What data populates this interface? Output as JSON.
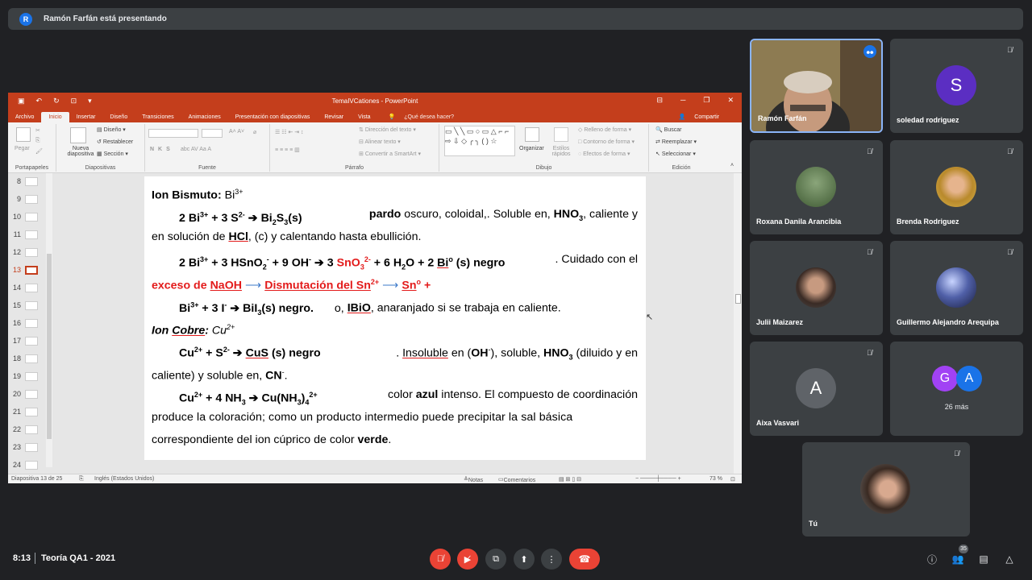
{
  "presenting_banner": {
    "avatar_letter": "R",
    "text": "Ramón Farfán está presentando"
  },
  "ppt": {
    "window_title": "TemaIVCationes - PowerPoint",
    "tabs": [
      "Archivo",
      "Inicio",
      "Insertar",
      "Diseño",
      "Transiciones",
      "Animaciones",
      "Presentación con diapositivas",
      "Revisar",
      "Vista"
    ],
    "tell_me": "¿Qué desea hacer?",
    "share": "Compartir",
    "ribbon": {
      "paste": "Pegar",
      "new_slide": "Nueva diapositiva",
      "layout": "Diseño",
      "reset": "Restablecer",
      "section": "Sección",
      "text_direction": "Dirección del texto",
      "align_text": "Alinear texto",
      "convert_smartart": "Convertir a SmartArt",
      "arrange": "Organizar",
      "quick_styles": "Estilos rápidos",
      "shape_fill": "Relleno de forma",
      "shape_outline": "Contorno de forma",
      "shape_effects": "Efectos de forma",
      "find": "Buscar",
      "replace": "Reemplazar",
      "select": "Seleccionar",
      "groups": [
        "Portapapeles",
        "Diapositivas",
        "Fuente",
        "Párrafo",
        "Dibujo",
        "Edición"
      ]
    },
    "thumbnails": [
      "8",
      "9",
      "10",
      "11",
      "12",
      "13",
      "14",
      "15",
      "16",
      "17",
      "18",
      "19",
      "20",
      "21",
      "22",
      "23",
      "24"
    ],
    "selected_slide": "13",
    "slide": {
      "l1_label": "Ion Bismuto:",
      "l1_ion": "Bi",
      "l1_sup": "3+",
      "l2_a": "2 Bi",
      "l2_a_sup": "3+",
      "l2_b": " + 3 S",
      "l2_b_sup": "2-",
      "l2_arrow": " ➔ ",
      "l2_c": "Bi",
      "l2_c_sub1": "2",
      "l2_c2": "S",
      "l2_c_sub2": "3",
      "l2_c3": "(s)",
      "l2_pardo": "pardo",
      "l2_rest": " oscuro, coloidal,. Soluble en, ",
      "l2_hno3": "HNO",
      "l2_hno3_sub": "3",
      "l2_end": ", caliente y",
      "l3_a": "en solución de ",
      "l3_hcl": "HCl",
      "l3_b": ", (c) y calentando hasta ebullición.",
      "l4_a": "2 Bi",
      "l4_a_sup": "3+",
      "l4_b": " + 3 HSnO",
      "l4_b_sub": "2",
      "l4_b_sup": "-",
      "l4_c": " + 9 OH",
      "l4_c_sup": "-",
      "l4_arrow": " ➔ 3 ",
      "l4_sno3": "SnO",
      "l4_sno3_sub": "3",
      "l4_sno3_sup": "2-",
      "l4_d": " + 6 H",
      "l4_d_sub": "2",
      "l4_d2": "O + 2 ",
      "l4_bi": "Bi",
      "l4_bi_sup": "o",
      "l4_e": " (s)  negro",
      "l4_f": ". Cuidado con el",
      "l5_a": "exceso de ",
      "l5_naoh": "NaOH",
      "l5_dism": "Dismutación del Sn",
      "l5_dism_sup": "2+",
      "l5_sn": "Sn",
      "l5_sn_sup": "o",
      "l5_plus": " +",
      "l6_a": "Bi",
      "l6_a_sup": "3+",
      "l6_b": " + 3 I",
      "l6_b_sup": "-",
      "l6_c": " ➔ BiI",
      "l6_c_sub": "3",
      "l6_d": "(s) negro.",
      "l6_e": "o, ",
      "l6_bio": "IBiO",
      "l6_f": ", anaranjado si se trabaja en caliente.",
      "l7_label": "Ion ",
      "l7_cobre": "Cobre",
      "l7_colon": ":",
      "l7_ion": " Cu",
      "l7_sup": "2+",
      "l8_a": "Cu",
      "l8_a_sup": "2+",
      "l8_b": " + S",
      "l8_b_sup": "2-",
      "l8_c": " ➔ ",
      "l8_cus": "CuS",
      "l8_d": " (s) negro",
      "l8_e": ". ",
      "l8_insol": "Insoluble",
      "l8_f": " en (",
      "l8_oh": "OH",
      "l8_oh_sup": "-",
      "l8_g": "), soluble, ",
      "l8_hno3": "HNO",
      "l8_hno3_sub": "3",
      "l8_h": " (diluido y en",
      "l9_a": "caliente) y soluble en, ",
      "l9_cn": "CN",
      "l9_cn_sup": "-",
      "l9_b": ".",
      "l10_a": "Cu",
      "l10_a_sup": "2+",
      "l10_b": " + 4 NH",
      "l10_b_sub": "3",
      "l10_c": " ➔ Cu(NH",
      "l10_c_sub": "3",
      "l10_c2": ")",
      "l10_c_sub2": "4",
      "l10_c_sup": "2+",
      "l10_d": "color ",
      "l10_azul": "azul",
      "l10_e": " intenso. El compuesto de coordinación",
      "l11": "produce la coloración; como un producto intermedio puede precipitar la sal básica",
      "l12_a": "correspondiente del ion cúprico de color ",
      "l12_verde": "verde",
      "l12_b": "."
    },
    "status": {
      "slide_pos": "Diapositiva 13 de 25",
      "language": "Inglés (Estados Unidos)",
      "notes": "Notas",
      "comments": "Comentarios",
      "zoom": "73 %"
    }
  },
  "participants": [
    {
      "name": "Ramón Farfán",
      "kind": "video"
    },
    {
      "name": "soledad rodriguez",
      "initial": "S",
      "color": "#5b2ec2"
    },
    {
      "name": "Roxana Danila Arancibia",
      "kind": "photo"
    },
    {
      "name": "Brenda Rodriguez",
      "kind": "photo"
    },
    {
      "name": "Julii Maizarez",
      "kind": "photo"
    },
    {
      "name": "Guillermo Alejandro Arequipa",
      "kind": "photo"
    },
    {
      "name": "Aixa Vasvari",
      "initial": "A",
      "color": "#5f6368"
    },
    {
      "others": "26 más",
      "initial_g": "G",
      "initial_a": "A",
      "color_g": "#a142f4",
      "color_a": "#1a73e8"
    },
    {
      "name": "Tú",
      "kind": "photo"
    }
  ],
  "bottom": {
    "time": "8:13",
    "meeting": "Teoría QA1 - 2021",
    "participant_count": "35"
  }
}
